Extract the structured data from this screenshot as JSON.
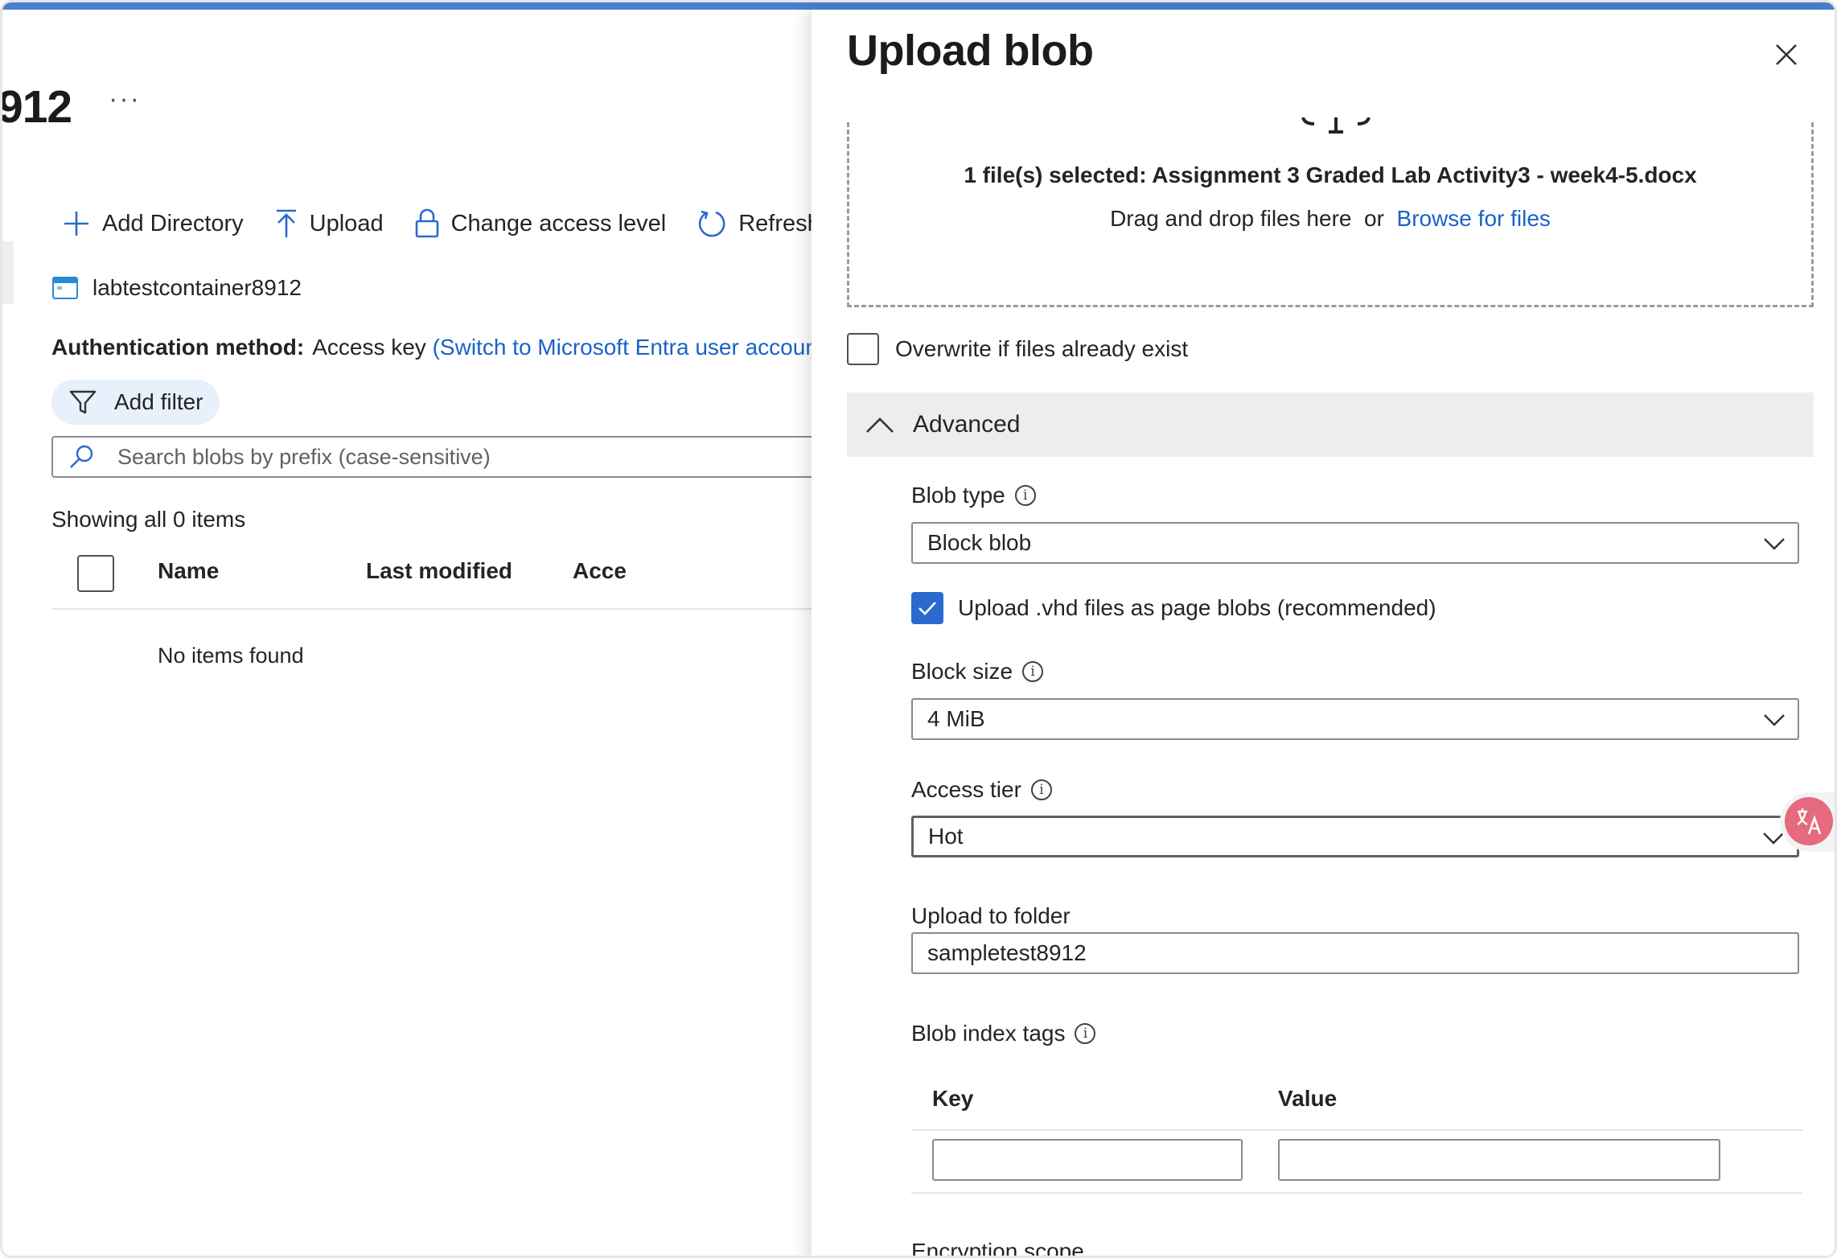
{
  "page": {
    "title": "912",
    "more_label": "···"
  },
  "toolbar": {
    "add_directory": "Add Directory",
    "upload": "Upload",
    "change_access_level": "Change access level",
    "refresh": "Refresh"
  },
  "container": {
    "name": "labtestcontainer8912"
  },
  "auth": {
    "label": "Authentication method:",
    "value": "Access key",
    "switch_link": "(Switch to Microsoft Entra user accoun"
  },
  "filter": {
    "add_filter": "Add filter"
  },
  "search": {
    "placeholder": "Search blobs by prefix (case-sensitive)"
  },
  "list": {
    "showing": "Showing all 0 items",
    "columns": [
      "Name",
      "Last modified",
      "Acce"
    ],
    "empty": "No items found"
  },
  "panel": {
    "title": "Upload blob",
    "selected_files": "1 file(s) selected: Assignment 3 Graded Lab Activity3 - week4-5.docx",
    "drag_text": "Drag and drop files here",
    "or_text": "or",
    "browse_link": "Browse for files",
    "overwrite_label": "Overwrite if files already exist",
    "overwrite_checked": false,
    "advanced_label": "Advanced",
    "blob_type_label": "Blob type",
    "blob_type_value": "Block blob",
    "vhd_label": "Upload .vhd files as page blobs (recommended)",
    "vhd_checked": true,
    "block_size_label": "Block size",
    "block_size_value": "4 MiB",
    "access_tier_label": "Access tier",
    "access_tier_value": "Hot",
    "folder_label": "Upload to folder",
    "folder_value": "sampletest8912",
    "index_tags_label": "Blob index tags",
    "tags_columns": [
      "Key",
      "Value"
    ],
    "tags_key_value": "",
    "tags_value_value": "",
    "encryption_label": "Encryption scope"
  },
  "colors": {
    "accent": "#4a7fd0",
    "link": "#1a62c8",
    "checkbox_checked": "#2a6ad0",
    "advanced_bg": "#ededed",
    "filter_bg": "#e8f0fb"
  },
  "icons": {
    "add_directory": "plus-icon",
    "upload": "upload-arrow-icon",
    "change_access": "lock-icon",
    "refresh": "refresh-icon",
    "container": "container-icon",
    "filter": "funnel-icon",
    "search": "search-icon",
    "close": "close-icon",
    "advanced": "chevron-up-icon",
    "dropdown": "chevron-down-icon",
    "info": "info-icon",
    "translate": "translate-icon"
  }
}
